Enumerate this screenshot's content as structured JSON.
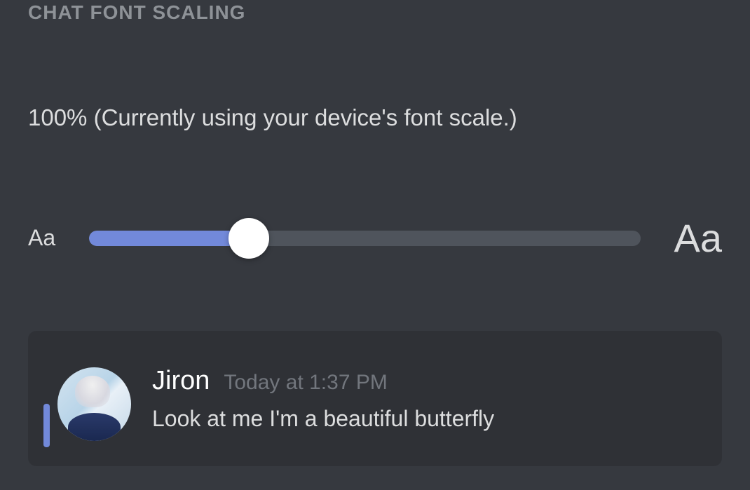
{
  "section": {
    "title": "CHAT FONT SCALING"
  },
  "scale": {
    "value": "100%",
    "description_suffix": " (Currently using your device's font scale.)"
  },
  "slider": {
    "small_label": "Aa",
    "large_label": "Aa",
    "fill_percent": 29
  },
  "preview": {
    "username": "Jiron",
    "timestamp": "Today at 1:37 PM",
    "message": "Look at me I'm a beautiful butterfly"
  }
}
